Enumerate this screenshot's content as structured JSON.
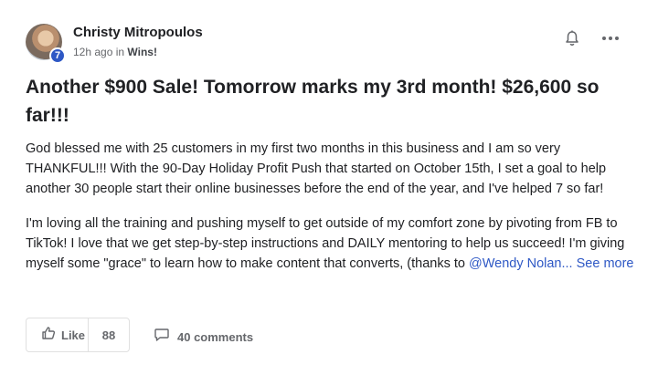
{
  "post": {
    "author": "Christy Mitropoulos",
    "level": "7",
    "time": "12h ago in ",
    "category": "Wins!",
    "title": "Another $900 Sale! Tomorrow marks my 3rd month! $26,600 so far!!!",
    "paragraph1": "God blessed me with 25 customers in my first two months in this business and I am so very THANKFUL!!! With the 90-Day Holiday Profit Push that started on October 15th, I set a goal to help another 30 people start their online businesses before the end of the year, and I've helped 7 so far!",
    "paragraph2": "I'm loving all the training and pushing myself to get outside of my comfort zone by pivoting from FB to TikTok! I love that we get step-by-step instructions and DAILY mentoring to help us succeed! I'm giving myself some \"grace\" to learn how to make content that converts, (thanks to ",
    "mention": "@Wendy Nolan",
    "see_more": "... See more"
  },
  "actions": {
    "like_label": "Like",
    "like_count": "88",
    "comments_label": "40 comments"
  },
  "icons": {
    "bell": "bell-icon",
    "more": "more-horizontal-icon",
    "like": "thumbs-up-icon",
    "comment": "comment-icon"
  },
  "colors": {
    "accent": "#2e58c5",
    "muted": "#65676b"
  }
}
